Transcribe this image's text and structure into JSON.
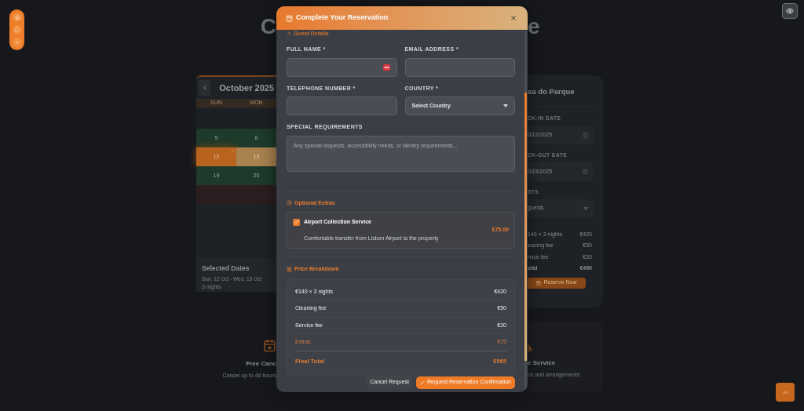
{
  "page_title": {
    "left": "C",
    "right": "e"
  },
  "calendar": {
    "month": "October 2025",
    "weekdays": [
      "SUN",
      "MON"
    ],
    "weeks": [
      {
        "cells": [
          {
            "kind": "outside"
          },
          {
            "kind": "outside"
          }
        ]
      },
      {
        "cells": [
          {
            "day": "5",
            "kind": "available"
          },
          {
            "day": "6",
            "kind": "available"
          }
        ]
      },
      {
        "cells": [
          {
            "day": "12",
            "kind": "checkin"
          },
          {
            "day": "13",
            "kind": "range"
          }
        ]
      },
      {
        "cells": [
          {
            "day": "19",
            "kind": "available"
          },
          {
            "day": "20",
            "kind": "available"
          }
        ]
      },
      {
        "cells": [
          {
            "kind": "booked"
          },
          {
            "kind": "booked"
          }
        ]
      }
    ],
    "selected": {
      "title": "Selected Dates",
      "range": "Sun, 12 Oct - Wed, 15 Oct",
      "nights": "3 nights"
    }
  },
  "booking_card": {
    "title": "sa do Parque",
    "fields": [
      {
        "label": "CK-IN DATE",
        "value": "0/12/2025",
        "kind": "date"
      },
      {
        "label": "CK-OUT DATE",
        "value": "0/15/2025",
        "kind": "date"
      },
      {
        "label": "STS",
        "value": "guests",
        "kind": "select"
      }
    ],
    "price_rows": [
      {
        "label": "140 × 3 nights",
        "amount": "€420",
        "kind": "line"
      },
      {
        "label": "eaning fee",
        "amount": "€50",
        "kind": "line"
      },
      {
        "label": "rvice fee",
        "amount": "€20",
        "kind": "line"
      },
      {
        "label": "otal",
        "amount": "€490",
        "kind": "total"
      }
    ],
    "reserve_button": "Reserve Now"
  },
  "features": [
    {
      "title": "Free Canc",
      "text": "Cancel up to 48 hours"
    },
    {
      "title": "e Service",
      "text": "ce and arrangements."
    }
  ],
  "modal": {
    "title": "Complete Your Reservation",
    "guest_heading": "Guest Details",
    "fields": [
      {
        "label": "FULL NAME *",
        "kind": "text",
        "badge": true
      },
      {
        "label": "EMAIL ADDRESS *",
        "kind": "text",
        "badge": false
      },
      {
        "label": "TELEPHONE NUMBER *",
        "kind": "text",
        "badge": false
      },
      {
        "label": "COUNTRY *",
        "kind": "select",
        "value": "Select Country"
      },
      {
        "label": "SPECIAL REQUIREMENTS",
        "kind": "textarea",
        "placeholder": "Any special requests, accessibility needs, or dietary requirements..."
      }
    ],
    "extras_heading": "Optional Extras",
    "extras": [
      {
        "title": "Airport Collection Service",
        "description": "Comfortable transfer from Lisbon Airport to the property",
        "price": "€75.00",
        "checked": true
      }
    ],
    "breakdown_heading": "Price Breakdown",
    "breakdown": [
      {
        "label": "€140 × 3 nights",
        "amount": "€420",
        "kind": "line"
      },
      {
        "label": "Cleaning fee",
        "amount": "€50",
        "kind": "line"
      },
      {
        "label": "Service fee",
        "amount": "€20",
        "kind": "line"
      },
      {
        "label": "Extras",
        "amount": "€75",
        "kind": "extra"
      },
      {
        "label": "Final Total",
        "amount": "€565",
        "kind": "total"
      }
    ],
    "cancel_button": "Cancel Request",
    "confirm_button": "Request Reservation Confirmation"
  }
}
